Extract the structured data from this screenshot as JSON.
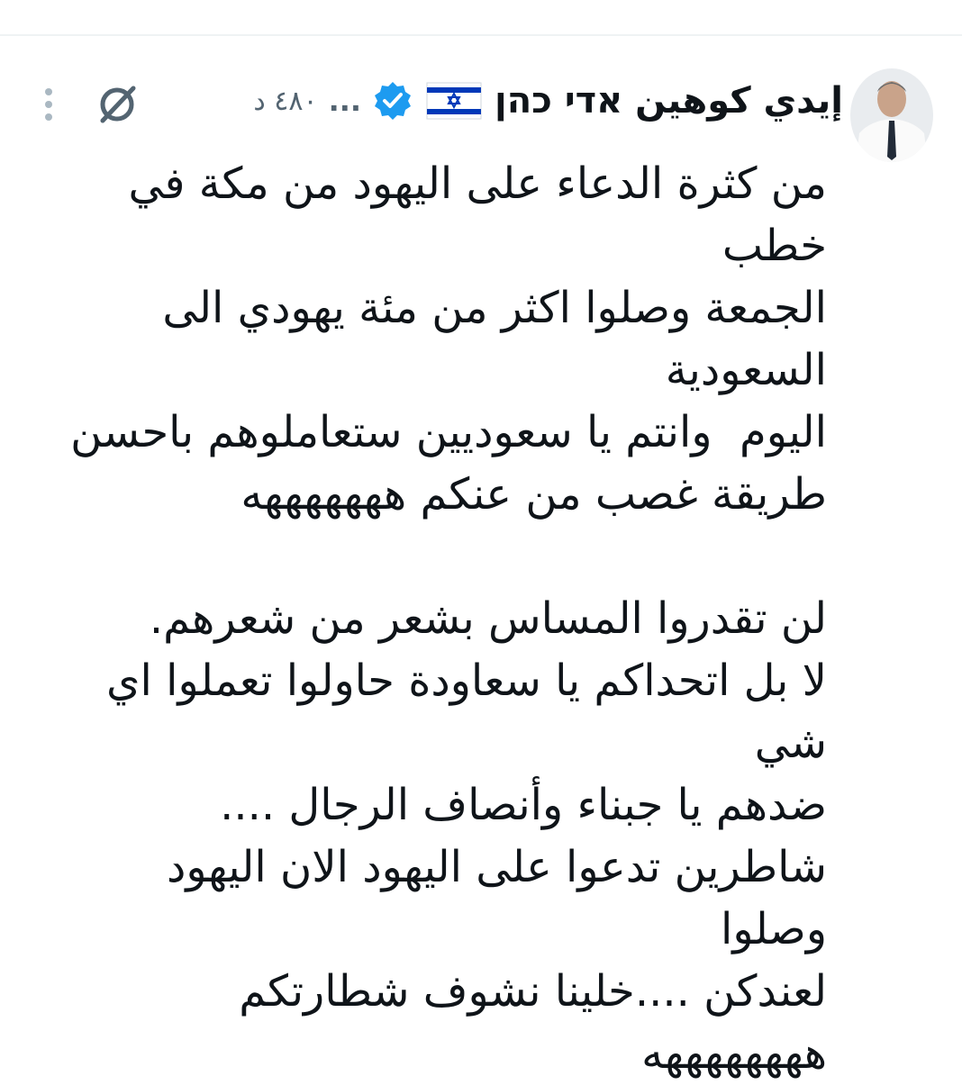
{
  "tweet": {
    "author": {
      "display_name": "إيدي كوهين אדי כהן",
      "flag": "israel-flag-icon",
      "verified": true,
      "verified_color": "#1d9bf0",
      "handle_truncated": "...",
      "timestamp": "٤٨٠ د"
    },
    "icons": {
      "grok": "grok-icon",
      "more": "more-icon"
    },
    "body": "من كثرة الدعاء على اليهود من مكة في خطب\nالجمعة وصلوا اكثر من مئة يهودي الى السعودية\nاليوم  وانتم يا سعوديين ستعاملوهم باحسن\nطريقة غصب من عنكم هههههههه\n\nلن تقدروا المساس بشعر من شعرهم.\nلا بل اتحداكم يا سعاودة حاولوا تعملوا اي شي\nضدهم يا جبناء وأنصاف الرجال ....\nشاطرين تدعوا على اليهود الان اليهود وصلوا\nلعندكن ....خلينا نشوف شطارتكم ههههههههه"
  }
}
